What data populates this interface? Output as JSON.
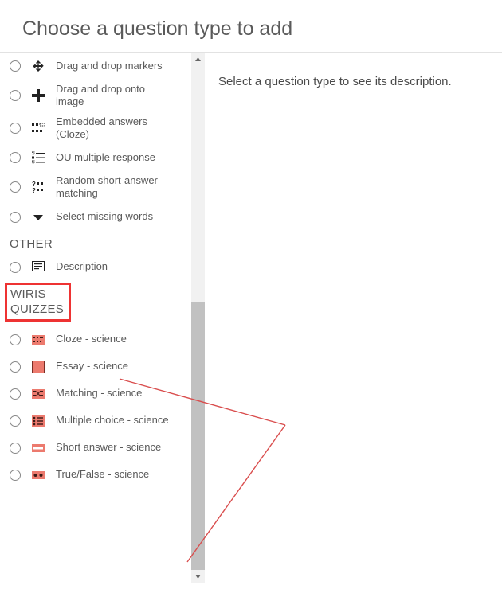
{
  "title": "Choose a question type to add",
  "description_prompt": "Select a question type to see its description.",
  "sections": {
    "top_items": [
      {
        "label": "Drag and drop markers",
        "icon": "dd-markers"
      },
      {
        "label": "Drag and drop onto image",
        "icon": "dd-image"
      },
      {
        "label": "Embedded answers (Cloze)",
        "icon": "cloze"
      },
      {
        "label": "OU multiple response",
        "icon": "ou-mr"
      },
      {
        "label": "Random short-answer matching",
        "icon": "random-sa"
      },
      {
        "label": "Select missing words",
        "icon": "missing-words"
      }
    ],
    "other_h": "OTHER",
    "other_items": [
      {
        "label": "Description",
        "icon": "description"
      }
    ],
    "wiris_h": "WIRIS QUIZZES",
    "wiris_items": [
      {
        "label": "Cloze - science",
        "icon": "w-cloze"
      },
      {
        "label": "Essay - science",
        "icon": "w-essay"
      },
      {
        "label": "Matching - science",
        "icon": "w-matching"
      },
      {
        "label": "Multiple choice - science",
        "icon": "w-mc"
      },
      {
        "label": "Short answer - science",
        "icon": "w-sa"
      },
      {
        "label": "True/False - science",
        "icon": "w-tf"
      }
    ]
  },
  "annotation": {
    "highlight": "WIRIS QUIZZES",
    "arrow_color": "#d94d4d"
  }
}
